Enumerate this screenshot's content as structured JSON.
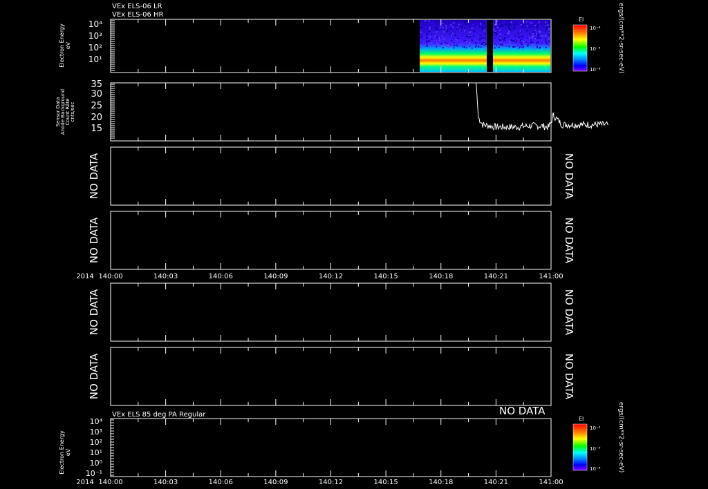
{
  "header": {
    "line1": "VEx ELS-06 LR",
    "line2": "VEx ELS-06 HR",
    "units": "ergs/(cm**2-sr-sec-eV)"
  },
  "colorbar": {
    "label": "El",
    "tick_top": "10⁻⁴",
    "tick_mid": "10⁻⁶",
    "tick_bot": "10⁻⁸",
    "colors": [
      "#ff0000",
      "#ff8000",
      "#ffff00",
      "#00ff00",
      "#00ffff",
      "#0080ff",
      "#0000ff",
      "#8000ff"
    ]
  },
  "time_axis": {
    "year": "2014",
    "ticks": [
      "140:00",
      "140:03",
      "140:06",
      "140:09",
      "140:12",
      "140:15",
      "140:18",
      "140:21",
      "141:00"
    ]
  },
  "panel1": {
    "ylabel": "Electron Energy",
    "yunit": "eV",
    "yticks": [
      "10⁴",
      "10³",
      "10²",
      "10¹"
    ]
  },
  "panel2": {
    "ylabel1": "Sensor Data",
    "ylabel2": "Anode Background",
    "ylabel3": "Count Rate",
    "ylabel4": "cnts/sec",
    "yticks": [
      "35",
      "30",
      "25",
      "20",
      "15"
    ]
  },
  "nodata": {
    "text": "NO DATA",
    "overlay": "NO DATA"
  },
  "panel7": {
    "title": "VEx ELS 85 deg PA Regular",
    "ylabel": "Electron Energy",
    "yunit": "eV",
    "yticks": [
      "10⁴",
      "10³",
      "10²",
      "10¹",
      "10⁰",
      "10⁻¹"
    ]
  },
  "chart_data": [
    {
      "type": "heatmap",
      "title": "VEx ELS-06 LR / VEx ELS-06 HR",
      "ylabel": "Electron Energy (eV)",
      "y_scale": "log",
      "ylim": [
        1,
        10000
      ],
      "x_range": [
        "140:00",
        "141:00"
      ],
      "data_intervals": [
        [
          "140:16.6",
          "140:19.8"
        ],
        [
          "140:20.0",
          "140:22.6"
        ]
      ],
      "peak_energy_eV": 10,
      "colorbar_range": [
        "1e-8",
        "1e-4"
      ]
    },
    {
      "type": "line",
      "ylabel": "Sensor Data Anode Background Count Rate (cnts/sec)",
      "ylim": [
        10,
        35
      ],
      "x_range": [
        "140:00",
        "141:00"
      ],
      "series": [
        {
          "x": [
            16.6,
            16.7,
            16.9,
            17.5,
            18.0,
            18.5,
            19.0,
            19.5,
            19.9,
            20.0,
            20.1,
            20.5,
            21.0,
            21.5,
            22.0,
            22.6
          ],
          "values": [
            35,
            20,
            17,
            16,
            16,
            16,
            16.5,
            16.5,
            16,
            18,
            21,
            17,
            17,
            17,
            17,
            17
          ]
        }
      ]
    },
    {
      "type": "table",
      "title": "NO DATA"
    },
    {
      "type": "table",
      "title": "NO DATA"
    },
    {
      "type": "table",
      "title": "NO DATA"
    },
    {
      "type": "table",
      "title": "NO DATA"
    },
    {
      "type": "heatmap",
      "title": "VEx ELS 85 deg PA Regular",
      "ylabel": "Electron Energy (eV)",
      "y_scale": "log",
      "ylim": [
        0.1,
        10000
      ],
      "x_range": [
        "140:00",
        "141:00"
      ]
    }
  ]
}
